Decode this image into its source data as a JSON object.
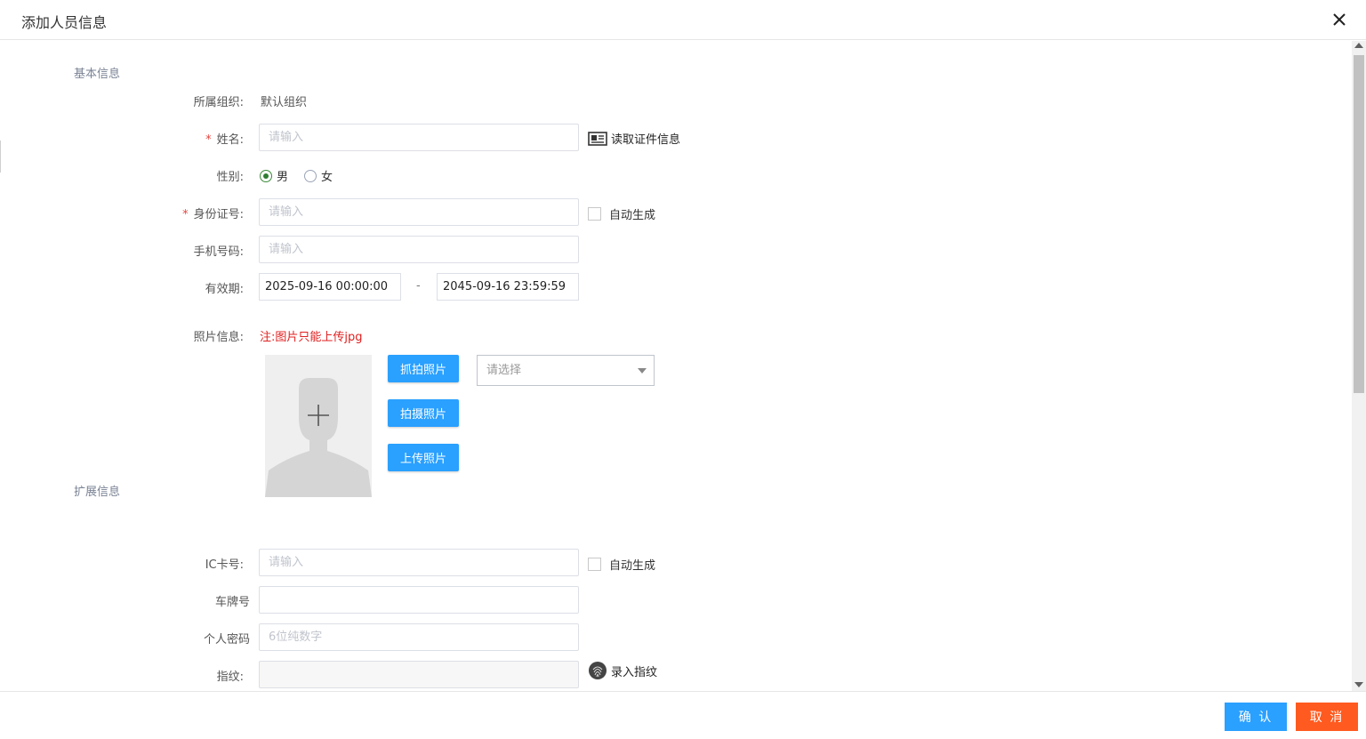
{
  "dialog": {
    "title": "添加人员信息",
    "close_icon": "close-icon"
  },
  "sections": {
    "basic": "基本信息",
    "extended": "扩展信息"
  },
  "basic": {
    "org": {
      "label": "所属组织:",
      "value": "默认组织"
    },
    "name": {
      "required_mark": "*",
      "label": "姓名:",
      "placeholder": "请输入",
      "value": "",
      "read_id_label": "读取证件信息",
      "read_id_icon": "id-card-icon"
    },
    "gender": {
      "label": "性别:",
      "options": [
        "男",
        "女"
      ],
      "selected": "男"
    },
    "id_number": {
      "required_mark": "*",
      "label": "身份证号:",
      "placeholder": "请输入",
      "value": "",
      "auto_label": "自动生成"
    },
    "phone": {
      "label": "手机号码:",
      "placeholder": "请输入",
      "value": ""
    },
    "validity": {
      "label": "有效期:",
      "start": "2025-09-16 00:00:00",
      "separator": "-",
      "end": "2045-09-16 23:59:59"
    },
    "photo": {
      "label": "照片信息:",
      "note": "注:图片只能上传jpg",
      "placeholder_icon": "avatar-placeholder-icon",
      "capture_label": "抓拍照片",
      "shoot_label": "拍摄照片",
      "upload_label": "上传照片",
      "select_placeholder": "请选择"
    }
  },
  "extended": {
    "ic_card": {
      "label": "IC卡号:",
      "placeholder": "请输入",
      "value": "",
      "auto_label": "自动生成"
    },
    "plate": {
      "label": "车牌号",
      "placeholder": "",
      "value": ""
    },
    "password": {
      "label": "个人密码",
      "placeholder": "6位纯数字",
      "value": ""
    },
    "fingerprint": {
      "label": "指纹:",
      "value": "",
      "action_label": "录入指纹",
      "icon": "fingerprint-icon"
    }
  },
  "footer": {
    "confirm_label": "确 认",
    "cancel_label": "取 消"
  },
  "colors": {
    "primary": "#2aa0ff",
    "cancel": "#ff5a1f",
    "required": "#e6443f",
    "note": "#e02020"
  }
}
